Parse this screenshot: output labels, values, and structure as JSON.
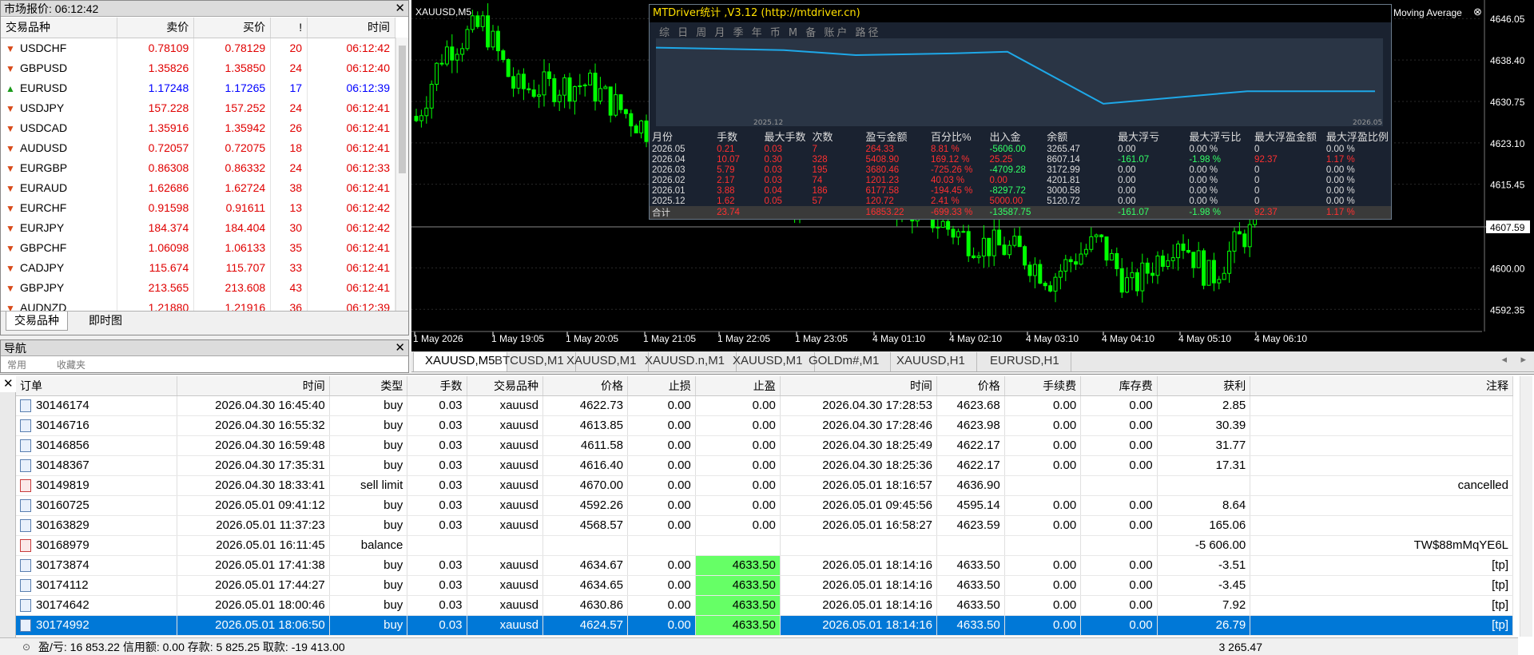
{
  "market_watch": {
    "title": "市场报价: 06:12:42",
    "headers": [
      "交易品种",
      "卖价",
      "买价",
      "!",
      "时间"
    ],
    "rows": [
      {
        "symbol": "USDCHF",
        "bid": "0.78109",
        "ask": "0.78129",
        "spread": "20",
        "time": "06:12:42",
        "dir": "down"
      },
      {
        "symbol": "GBPUSD",
        "bid": "1.35826",
        "ask": "1.35850",
        "spread": "24",
        "time": "06:12:40",
        "dir": "down"
      },
      {
        "symbol": "EURUSD",
        "bid": "1.17248",
        "ask": "1.17265",
        "spread": "17",
        "time": "06:12:39",
        "dir": "up"
      },
      {
        "symbol": "USDJPY",
        "bid": "157.228",
        "ask": "157.252",
        "spread": "24",
        "time": "06:12:41",
        "dir": "down"
      },
      {
        "symbol": "USDCAD",
        "bid": "1.35916",
        "ask": "1.35942",
        "spread": "26",
        "time": "06:12:41",
        "dir": "down"
      },
      {
        "symbol": "AUDUSD",
        "bid": "0.72057",
        "ask": "0.72075",
        "spread": "18",
        "time": "06:12:41",
        "dir": "down"
      },
      {
        "symbol": "EURGBP",
        "bid": "0.86308",
        "ask": "0.86332",
        "spread": "24",
        "time": "06:12:33",
        "dir": "down"
      },
      {
        "symbol": "EURAUD",
        "bid": "1.62686",
        "ask": "1.62724",
        "spread": "38",
        "time": "06:12:41",
        "dir": "down"
      },
      {
        "symbol": "EURCHF",
        "bid": "0.91598",
        "ask": "0.91611",
        "spread": "13",
        "time": "06:12:42",
        "dir": "down"
      },
      {
        "symbol": "EURJPY",
        "bid": "184.374",
        "ask": "184.404",
        "spread": "30",
        "time": "06:12:42",
        "dir": "down"
      },
      {
        "symbol": "GBPCHF",
        "bid": "1.06098",
        "ask": "1.06133",
        "spread": "35",
        "time": "06:12:41",
        "dir": "down"
      },
      {
        "symbol": "CADJPY",
        "bid": "115.674",
        "ask": "115.707",
        "spread": "33",
        "time": "06:12:41",
        "dir": "down"
      },
      {
        "symbol": "GBPJPY",
        "bid": "213.565",
        "ask": "213.608",
        "spread": "43",
        "time": "06:12:41",
        "dir": "down"
      },
      {
        "symbol": "AUDNZD",
        "bid": "1.21880",
        "ask": "1.21916",
        "spread": "36",
        "time": "06:12:39",
        "dir": "down"
      }
    ],
    "tabs": [
      "交易品种",
      "即时图"
    ]
  },
  "navigator": {
    "title": "导航",
    "tabs": [
      "常用",
      "收藏夹"
    ]
  },
  "chart": {
    "symbol_label": "XAUUSD,M5",
    "indicator": "Moving Average",
    "price_levels": [
      "4646.05",
      "4638.40",
      "4630.75",
      "4623.10",
      "4615.45",
      "4607.59",
      "4600.00",
      "4592.35"
    ],
    "current_price": "4607.59",
    "time_labels": [
      "1 May 2026",
      "1 May 19:05",
      "1 May 20:05",
      "1 May 21:05",
      "1 May 22:05",
      "1 May 23:05",
      "4 May 01:10",
      "4 May 02:10",
      "4 May 03:10",
      "4 May 04:10",
      "4 May 05:10",
      "4 May 06:10"
    ]
  },
  "stats": {
    "title": "MTDriver统计 ,V3.12 (http://mtdriver.cn)",
    "toolbar": "综 日 周 月 季 年 币 M 备 账户  路径",
    "axis_left": "2025.12",
    "axis_right": "2026.05",
    "headers": [
      "月份",
      "手数",
      "最大手数",
      "次数",
      "盈亏金额",
      "百分比%",
      "出入金",
      "余额",
      "最大浮亏",
      "最大浮亏比",
      "最大浮盈金额",
      "最大浮盈比例"
    ],
    "rows": [
      [
        "2026.05",
        "0.21",
        "0.03",
        "7",
        "264.33",
        "8.81 %",
        "-5606.00",
        "3265.47",
        "0.00",
        "0.00 %",
        "0",
        "0.00 %"
      ],
      [
        "2026.04",
        "10.07",
        "0.30",
        "328",
        "5408.90",
        "169.12 %",
        "25.25",
        "8607.14",
        "-161.07",
        "-1.98 %",
        "92.37",
        "1.17 %"
      ],
      [
        "2026.03",
        "5.79",
        "0.03",
        "195",
        "3680.46",
        "-725.26 %",
        "-4709.28",
        "3172.99",
        "0.00",
        "0.00 %",
        "0",
        "0.00 %"
      ],
      [
        "2026.02",
        "2.17",
        "0.03",
        "74",
        "1201.23",
        "40.03 %",
        "0.00",
        "4201.81",
        "0.00",
        "0.00 %",
        "0",
        "0.00 %"
      ],
      [
        "2026.01",
        "3.88",
        "0.04",
        "186",
        "6177.58",
        "-194.45 %",
        "-8297.72",
        "3000.58",
        "0.00",
        "0.00 %",
        "0",
        "0.00 %"
      ],
      [
        "2025.12",
        "1.62",
        "0.05",
        "57",
        "120.72",
        "2.41 %",
        "5000.00",
        "5120.72",
        "0.00",
        "0.00 %",
        "0",
        "0.00 %"
      ],
      [
        "合计",
        "23.74",
        "",
        "",
        "16853.22",
        "-699.33 %",
        "-13587.75",
        "",
        "-161.07",
        "-1.98 %",
        "92.37",
        "1.17 %"
      ]
    ]
  },
  "chart_tabs": [
    "XAUUSD,M5",
    "BTCUSD,M1",
    "XAUUSD,M1",
    "XAUUSD.n,M1",
    "XAUUSD,M1",
    "GOLDm#,M1",
    "XAUUSD,H1",
    "EURUSD,H1"
  ],
  "orders": {
    "headers": [
      "订单",
      "时间",
      "类型",
      "手数",
      "交易品种",
      "价格",
      "止损",
      "止盈",
      "时间",
      "价格",
      "手续费",
      "库存费",
      "获利",
      "注释"
    ],
    "rows": [
      [
        "30146174",
        "2026.04.30 16:45:40",
        "buy",
        "0.03",
        "xauusd",
        "4622.73",
        "0.00",
        "0.00",
        "2026.04.30 17:28:53",
        "4623.68",
        "0.00",
        "0.00",
        "2.85",
        ""
      ],
      [
        "30146716",
        "2026.04.30 16:55:32",
        "buy",
        "0.03",
        "xauusd",
        "4613.85",
        "0.00",
        "0.00",
        "2026.04.30 17:28:46",
        "4623.98",
        "0.00",
        "0.00",
        "30.39",
        ""
      ],
      [
        "30146856",
        "2026.04.30 16:59:48",
        "buy",
        "0.03",
        "xauusd",
        "4611.58",
        "0.00",
        "0.00",
        "2026.04.30 18:25:49",
        "4622.17",
        "0.00",
        "0.00",
        "31.77",
        ""
      ],
      [
        "30148367",
        "2026.04.30 17:35:31",
        "buy",
        "0.03",
        "xauusd",
        "4616.40",
        "0.00",
        "0.00",
        "2026.04.30 18:25:36",
        "4622.17",
        "0.00",
        "0.00",
        "17.31",
        ""
      ],
      [
        "30149819",
        "2026.04.30 18:33:41",
        "sell limit",
        "0.03",
        "xauusd",
        "4670.00",
        "0.00",
        "0.00",
        "2026.05.01 18:16:57",
        "4636.90",
        "",
        "",
        "",
        "cancelled"
      ],
      [
        "30160725",
        "2026.05.01 09:41:12",
        "buy",
        "0.03",
        "xauusd",
        "4592.26",
        "0.00",
        "0.00",
        "2026.05.01 09:45:56",
        "4595.14",
        "0.00",
        "0.00",
        "8.64",
        ""
      ],
      [
        "30163829",
        "2026.05.01 11:37:23",
        "buy",
        "0.03",
        "xauusd",
        "4568.57",
        "0.00",
        "0.00",
        "2026.05.01 16:58:27",
        "4623.59",
        "0.00",
        "0.00",
        "165.06",
        ""
      ],
      [
        "30168979",
        "2026.05.01 16:11:45",
        "balance",
        "",
        "",
        "",
        "",
        "",
        "",
        "",
        "",
        "",
        "-5 606.00",
        "TW$88mMqYE6L"
      ],
      [
        "30173874",
        "2026.05.01 17:41:38",
        "buy",
        "0.03",
        "xauusd",
        "4634.67",
        "0.00",
        "4633.50",
        "2026.05.01 18:14:16",
        "4633.50",
        "0.00",
        "0.00",
        "-3.51",
        "[tp]"
      ],
      [
        "30174112",
        "2026.05.01 17:44:27",
        "buy",
        "0.03",
        "xauusd",
        "4634.65",
        "0.00",
        "4633.50",
        "2026.05.01 18:14:16",
        "4633.50",
        "0.00",
        "0.00",
        "-3.45",
        "[tp]"
      ],
      [
        "30174642",
        "2026.05.01 18:00:46",
        "buy",
        "0.03",
        "xauusd",
        "4630.86",
        "0.00",
        "4633.50",
        "2026.05.01 18:14:16",
        "4633.50",
        "0.00",
        "0.00",
        "7.92",
        "[tp]"
      ],
      [
        "30174992",
        "2026.05.01 18:06:50",
        "buy",
        "0.03",
        "xauusd",
        "4624.57",
        "0.00",
        "4633.50",
        "2026.05.01 18:14:16",
        "4633.50",
        "0.00",
        "0.00",
        "26.79",
        "[tp]"
      ]
    ],
    "summary": "盈/亏: 16 853.22  信用额: 0.00  存款: 5 825.25  取款: -19 413.00",
    "total": "3 265.47"
  },
  "colors": {
    "bid": "#e00000",
    "ask_up": "#0000ff",
    "candle": "#00ff00",
    "tp": "#66ff66",
    "selected": "#0078d7"
  }
}
